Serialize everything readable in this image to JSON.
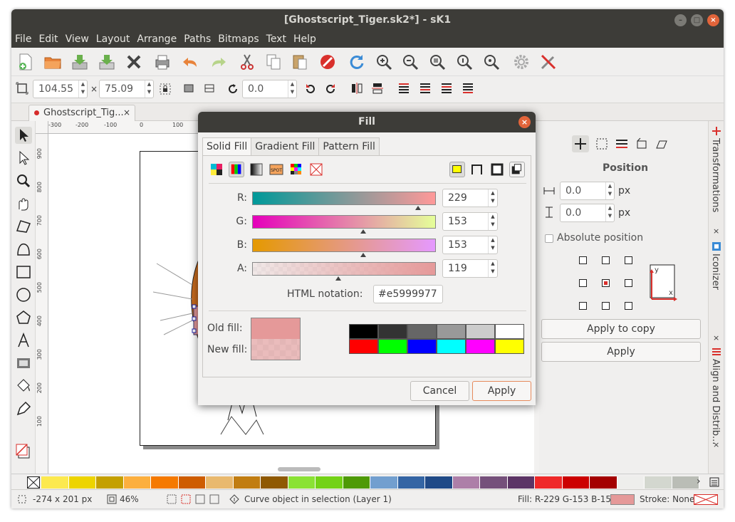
{
  "window": {
    "title": "[Ghostscript_Tiger.sk2*] - sK1"
  },
  "menu": [
    "File",
    "Edit",
    "View",
    "Layout",
    "Arrange",
    "Paths",
    "Bitmaps",
    "Text",
    "Help"
  ],
  "toolbar2": {
    "width": "104.55",
    "times": "×",
    "height": "75.09",
    "rotation": "0.0"
  },
  "doc_tab": {
    "label": "Ghostscript_Tig...",
    "close": "×"
  },
  "ruler_top_labels": [
    "-300",
    "-200",
    "-100",
    "0",
    "100"
  ],
  "ruler_left_labels": [
    "900",
    "800",
    "700",
    "600",
    "500",
    "400",
    "300",
    "200",
    "100"
  ],
  "right_panel": {
    "section_title": "Position",
    "x_value": "0.0",
    "y_value": "0.0",
    "unit": "px",
    "absolute_label": "Absolute position",
    "apply_copy": "Apply to copy",
    "apply": "Apply",
    "axis_y": "y",
    "axis_x": "x"
  },
  "side_tabs": [
    "Transformations",
    "Iconizer",
    "Align and Distrib..."
  ],
  "dialog": {
    "title": "Fill",
    "tabs": [
      "Solid Fill",
      "Gradient Fill",
      "Pattern Fill"
    ],
    "channels": [
      {
        "label": "R:",
        "value": "229",
        "fraction": 0.898,
        "gradient": "linear-gradient(90deg,#009999,#ff9999)"
      },
      {
        "label": "G:",
        "value": "153",
        "fraction": 0.6,
        "gradient": "linear-gradient(90deg,#e500bb,#e5ff99)"
      },
      {
        "label": "B:",
        "value": "153",
        "fraction": 0.6,
        "gradient": "linear-gradient(90deg,#e59900,#e599ff)"
      },
      {
        "label": "A:",
        "value": "119",
        "fraction": 0.467,
        "gradient": "linear-gradient(90deg,rgba(229,153,153,0.1),#e59999)"
      }
    ],
    "html_label": "HTML notation:",
    "html_value": "#e5999977",
    "old_fill_label": "Old fill:",
    "new_fill_label": "New fill:",
    "old_fill_color": "#e59999",
    "new_fill_color": "#f2cccc",
    "palette": [
      "#000000",
      "#333333",
      "#666666",
      "#999999",
      "#cccccc",
      "#ffffff",
      "#ff0000",
      "#00ff00",
      "#0000ff",
      "#00ffff",
      "#ff00ff",
      "#ffff00"
    ],
    "cancel": "Cancel",
    "apply": "Apply"
  },
  "color_palette": [
    "#fce94f",
    "#edd400",
    "#c4a000",
    "#fcaf3e",
    "#f57900",
    "#ce5c00",
    "#e9b96e",
    "#c17d11",
    "#8f5902",
    "#8ae234",
    "#73d216",
    "#4e9a06",
    "#729fcf",
    "#3465a4",
    "#204a87",
    "#ad7fa8",
    "#75507b",
    "#5c3566",
    "#ef2929",
    "#cc0000",
    "#a40000",
    "#eeeeec",
    "#d3d7cf",
    "#babdb6"
  ],
  "status": {
    "size": "-274 x 201 px",
    "zoom": "46%",
    "message": "Curve object in selection (Layer 1)",
    "fill": "Fill: R-229 G-153 B-153",
    "stroke": "Stroke: None",
    "fill_color": "#e59999"
  }
}
